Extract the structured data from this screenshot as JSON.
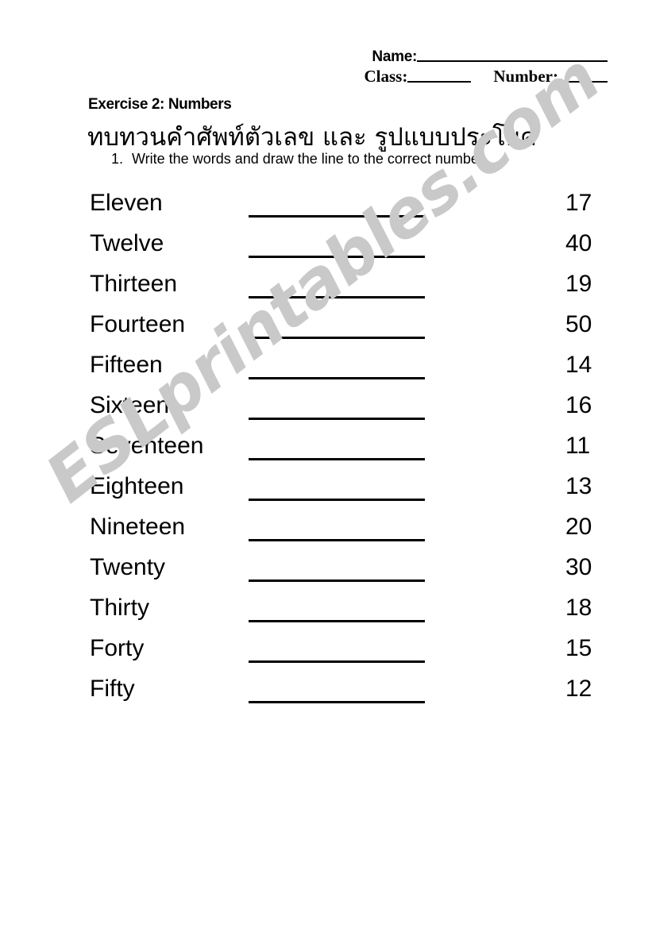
{
  "header": {
    "name_label": "Name:",
    "class_label": "Class:",
    "number_label": "Number:"
  },
  "titles": {
    "exercise": "Exercise 2: Numbers",
    "thai": "ทบทวนคำศัพท์ตัวเลข และ รูปแบบประโยค",
    "instruction_number": "1.",
    "instruction_text": "Write the words and draw the line to the correct number."
  },
  "watermark": {
    "text": "ESLprintables.com",
    "color": "#c9c9c9"
  },
  "exercise": {
    "rows": [
      {
        "word": "Eleven",
        "number": "17"
      },
      {
        "word": "Twelve",
        "number": "40"
      },
      {
        "word": "Thirteen",
        "number": "19"
      },
      {
        "word": "Fourteen",
        "number": "50"
      },
      {
        "word": "Fifteen",
        "number": "14"
      },
      {
        "word": "Sixteen",
        "number": "16"
      },
      {
        "word": "Seventeen",
        "number": "11"
      },
      {
        "word": "Eighteen",
        "number": "13"
      },
      {
        "word": "Nineteen",
        "number": "20"
      },
      {
        "word": "Twenty",
        "number": "30"
      },
      {
        "word": "Thirty",
        "number": "18"
      },
      {
        "word": "Forty",
        "number": "15"
      },
      {
        "word": "Fifty",
        "number": "12"
      }
    ]
  }
}
